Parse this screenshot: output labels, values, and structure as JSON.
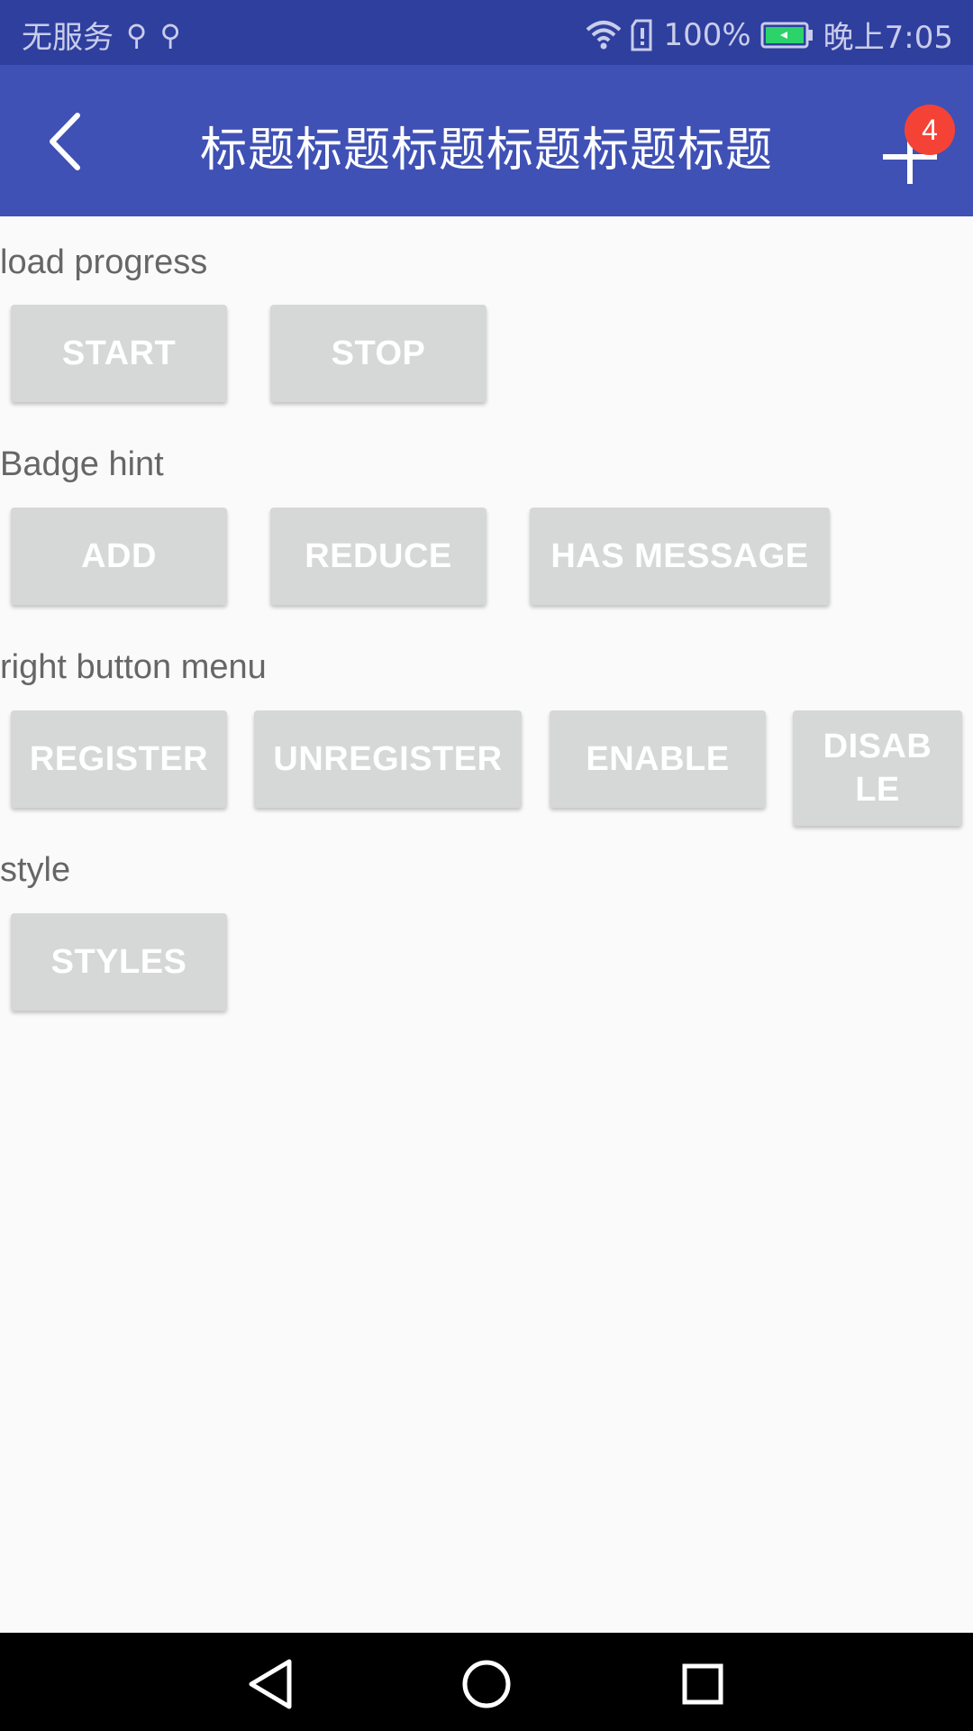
{
  "status_bar": {
    "carrier": "无服务",
    "battery": "100%",
    "time": "晚上7:05",
    "icons": [
      "usb-icon",
      "usb-icon",
      "wifi-icon",
      "sd-card-alert-icon",
      "battery-charging-icon"
    ]
  },
  "app_bar": {
    "title": "标题标题标题标题标题标题",
    "back_icon": "chevron-left-icon",
    "action_icon": "plus-icon",
    "badge_count": "4",
    "colors": {
      "bar": "#3f51b5",
      "status": "#2f3f9e",
      "badge": "#f44336"
    }
  },
  "sections": [
    {
      "label": "load progress",
      "buttons": [
        "START",
        "STOP"
      ]
    },
    {
      "label": "Badge hint",
      "buttons": [
        "ADD",
        "REDUCE",
        "HAS MESSAGE"
      ]
    },
    {
      "label": "right button menu",
      "buttons": [
        "REGISTER",
        "UNREGISTER",
        "ENABLE",
        "DISABLE"
      ]
    },
    {
      "label": "style",
      "buttons": [
        "STYLES"
      ]
    }
  ],
  "nav_bar": {
    "icons": [
      "back-triangle-icon",
      "home-circle-icon",
      "recents-square-icon"
    ]
  }
}
